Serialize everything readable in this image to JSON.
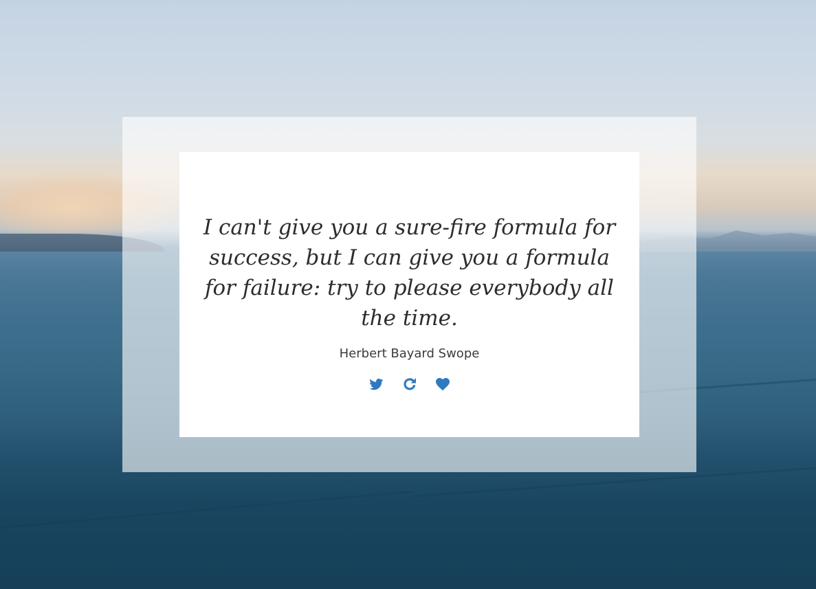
{
  "quote": {
    "text": "I can't give you a sure-fire formula for success, but I can give you a formula for failure: try to please everybody all the time.",
    "author": "Herbert Bayard Swope"
  },
  "actions": [
    {
      "icon": "twitter-icon"
    },
    {
      "icon": "refresh-icon"
    },
    {
      "icon": "heart-icon"
    }
  ],
  "colors": {
    "icon": "#2f7abf",
    "text": "#2d2d2d",
    "card": "#ffffff"
  }
}
